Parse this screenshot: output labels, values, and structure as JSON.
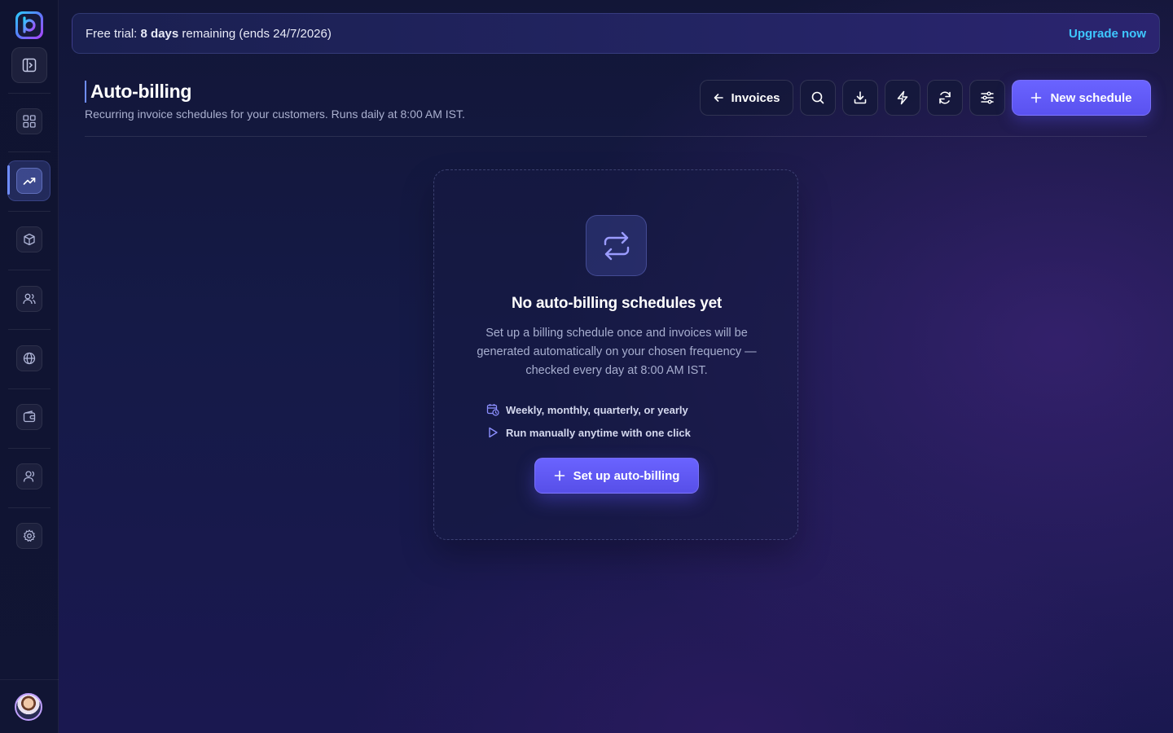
{
  "banner": {
    "prefix": "Free trial: ",
    "days": "8 days",
    "suffix": " remaining (ends 24/7/2026)",
    "upgrade_label": "Upgrade now"
  },
  "header": {
    "title": "Auto-billing",
    "subtitle": "Recurring invoice schedules for your customers. Runs daily at 8:00 AM IST."
  },
  "toolbar": {
    "invoices_label": "Invoices",
    "new_schedule_label": "New schedule"
  },
  "empty_state": {
    "title": "No auto-billing schedules yet",
    "description": "Set up a billing schedule once and invoices will be generated automatically on your chosen frequency — checked every day at 8:00 AM IST.",
    "features": [
      "Weekly, monthly, quarterly, or yearly",
      "Run manually anytime with one click"
    ],
    "cta_label": "Set up auto-billing"
  },
  "sidebar": {
    "items": [
      "dashboard-icon",
      "trending-icon",
      "box-icon",
      "users-icon",
      "globe-icon",
      "wallet-icon",
      "team-icon",
      "gear-icon"
    ],
    "active_item": "trending-icon"
  },
  "colors": {
    "accent": "#6a63ff",
    "link": "#3ec7ff",
    "active_indicator": "#6f8dff"
  }
}
